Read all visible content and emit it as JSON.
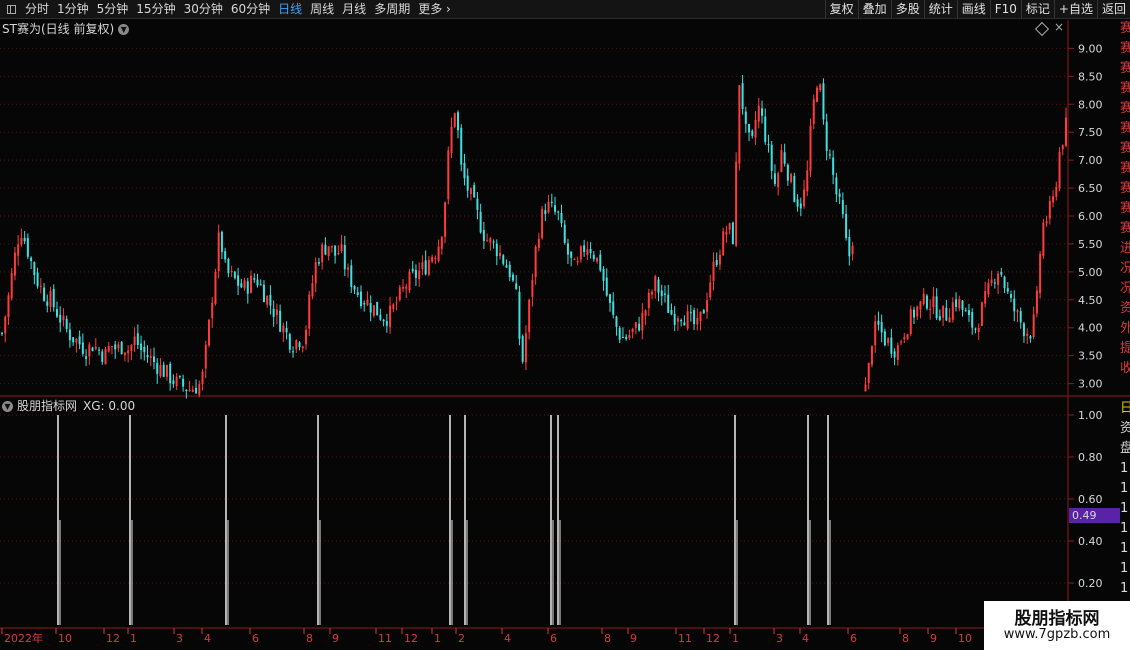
{
  "toolbar": {
    "periods": [
      "分时",
      "1分钟",
      "5分钟",
      "15分钟",
      "30分钟",
      "60分钟",
      "日线",
      "周线",
      "月线",
      "多周期",
      "更多"
    ],
    "active_period": "日线",
    "right_buttons": [
      "复权",
      "叠加",
      "多股",
      "统计",
      "画线",
      "F10",
      "标记",
      "+自选",
      "返回"
    ]
  },
  "main_chart": {
    "title": "ST赛为(日线 前复权)",
    "y_ticks": [
      "9.00",
      "8.50",
      "8.00",
      "7.50",
      "7.00",
      "6.50",
      "6.00",
      "5.50",
      "5.00",
      "4.50",
      "4.00",
      "3.50",
      "3.00"
    ]
  },
  "indicator": {
    "label": "股朋指标网",
    "xg_text": "XG: 0.00",
    "y_ticks": [
      "1.00",
      "0.80",
      "0.60",
      "0.40",
      "0.20"
    ],
    "cursor_value": "0.49"
  },
  "date_axis": {
    "labels": [
      "2022年",
      "10",
      "12",
      "1",
      "3",
      "4",
      "6",
      "8",
      "9",
      "11",
      "12",
      "1",
      "2",
      "4",
      "6",
      "8",
      "9",
      "11",
      "12",
      "1",
      "3",
      "4",
      "6",
      "8",
      "9",
      "10"
    ]
  },
  "right_strip": {
    "chars": [
      "赛",
      "赛",
      "赛",
      "赛",
      "赛",
      "赛",
      "赛",
      "赛",
      "赛",
      "赛",
      "赛",
      "进",
      "况",
      "况",
      "资",
      "外",
      "提",
      "收",
      "",
      "日",
      "资",
      "盘",
      "1",
      "1",
      "1",
      "1",
      "1",
      "1",
      "1",
      "1",
      "1"
    ]
  },
  "watermark": {
    "line1": "股朋指标网",
    "line2": "www.7gpzb.com"
  },
  "colors": {
    "up": "#ff3b3b",
    "down": "#3ee0e0",
    "grid": "#5a1010",
    "active": "#3aa3ff",
    "cursor_bg": "#5a22a8"
  },
  "chart_data": {
    "type": "candlestick",
    "ylim": [
      2.85,
      9.15
    ],
    "close_series": [
      3.9,
      4.5,
      5.2,
      5.8,
      5.5,
      5.1,
      4.8,
      4.6,
      4.5,
      4.3,
      4.1,
      3.9,
      3.8,
      3.7,
      3.6,
      3.7,
      3.6,
      3.5,
      3.7,
      3.6,
      3.7,
      3.6,
      3.8,
      3.6,
      3.5,
      3.4,
      3.3,
      3.2,
      3.1,
      3.0,
      2.95,
      2.9,
      2.95,
      3.0,
      3.8,
      4.8,
      5.7,
      5.0,
      4.9,
      4.8,
      4.7,
      4.8,
      4.9,
      4.7,
      4.5,
      4.3,
      4.1,
      3.9,
      3.7,
      3.8,
      3.8,
      4.6,
      5.2,
      5.4,
      5.5,
      5.3,
      5.4,
      5.0,
      4.8,
      4.6,
      4.5,
      4.4,
      4.3,
      4.2,
      4.2,
      4.4,
      4.6,
      4.8,
      4.9,
      5.0,
      5.1,
      5.3,
      5.4,
      5.9,
      7.3,
      8.0,
      6.8,
      6.5,
      6.2,
      5.9,
      5.6,
      5.5,
      5.4,
      5.2,
      5.0,
      4.6,
      3.3,
      4.2,
      5.2,
      5.9,
      6.2,
      6.1,
      6.0,
      5.5,
      5.2,
      5.0,
      5.4,
      5.5,
      5.3,
      5.1,
      4.6,
      4.2,
      3.9,
      3.8,
      3.9,
      4.0,
      4.2,
      4.5,
      4.8,
      4.6,
      4.4,
      4.2,
      4.3,
      4.2,
      4.1,
      4.0,
      4.3,
      4.8,
      5.2,
      5.5,
      5.8,
      5.6,
      8.5,
      7.5,
      7.2,
      8.0,
      7.6,
      7.0,
      6.5,
      7.2,
      6.8,
      6.4,
      6.2,
      6.5,
      7.8,
      8.6,
      7.5,
      7.0,
      6.4,
      6.0,
      5.2,
      5.8,
      null,
      2.9,
      3.9,
      4.0,
      3.8,
      3.7,
      3.6,
      3.9,
      4.1,
      4.3,
      4.4,
      4.5,
      4.4,
      4.3,
      4.2,
      4.4,
      4.5,
      4.3,
      4.1,
      4.0,
      4.3,
      4.6,
      4.9,
      5.1,
      4.7,
      4.4,
      4.2,
      4.0,
      3.9,
      4.2,
      5.8,
      6.0,
      6.3,
      7.2,
      7.6
    ]
  }
}
